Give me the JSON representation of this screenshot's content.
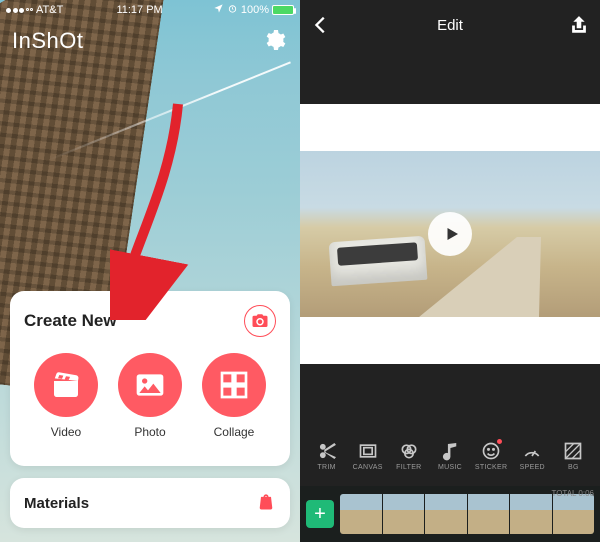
{
  "left": {
    "status": {
      "carrier": "AT&T",
      "time": "11:17 PM",
      "battery_pct": "100%"
    },
    "logo": "InShOt",
    "create": {
      "title": "Create New",
      "items": [
        {
          "key": "video",
          "label": "Video"
        },
        {
          "key": "photo",
          "label": "Photo"
        },
        {
          "key": "collage",
          "label": "Collage"
        }
      ]
    },
    "materials": {
      "title": "Materials"
    }
  },
  "right": {
    "header": {
      "title": "Edit"
    },
    "tools": [
      {
        "key": "trim",
        "label": "TRIM"
      },
      {
        "key": "canvas",
        "label": "CANVAS"
      },
      {
        "key": "filter",
        "label": "FILTER"
      },
      {
        "key": "music",
        "label": "MUSIC"
      },
      {
        "key": "sticker",
        "label": "STICKER",
        "dot": true
      },
      {
        "key": "speed",
        "label": "SPEED"
      },
      {
        "key": "bg",
        "label": "BG"
      }
    ],
    "timeline": {
      "add_glyph": "+",
      "total_label": "TOTAL 0:06"
    }
  }
}
